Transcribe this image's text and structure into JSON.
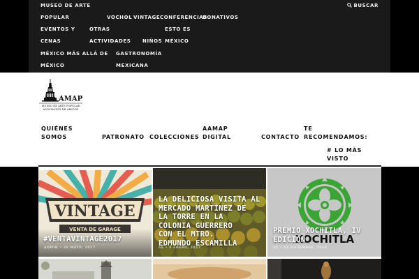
{
  "topbar": {
    "menu": [
      {
        "id": "museo",
        "label": "MUSEO DE ARTE"
      },
      {
        "id": "popular",
        "label": "POPULAR"
      },
      {
        "id": "vochol",
        "label": "VOCHOL"
      },
      {
        "id": "vintage",
        "label": "VINTAGE"
      },
      {
        "id": "conferencias",
        "label": "CONFERENCIAS"
      },
      {
        "id": "donativos",
        "label": "DONATIVOS"
      },
      {
        "id": "eventos",
        "label": "EVENTOS Y"
      },
      {
        "id": "otras",
        "label": "OTRAS"
      },
      {
        "id": "esto-es",
        "label": "ESTO ES"
      },
      {
        "id": "cenas",
        "label": "CENAS"
      },
      {
        "id": "actividades",
        "label": "ACTIVIDADES"
      },
      {
        "id": "ninos",
        "label": "NIÑOS"
      },
      {
        "id": "mexico",
        "label": "MÉXICO"
      },
      {
        "id": "mexico-mas",
        "label": "MÉXICO MÁS ALLÁ DE"
      },
      {
        "id": "gastronomia",
        "label": "GASTRONOMÍA"
      },
      {
        "id": "mexico2",
        "label": "MÉXICO"
      },
      {
        "id": "mexicana",
        "label": "MEXICANA"
      }
    ],
    "search_label": "BUSCAR",
    "search_icon": "search-icon"
  },
  "logo": {
    "wordmark": "AMAP",
    "lines": [
      "MUSEO DE ARTE POPULAR",
      "ASOCIACIÓN DE AMIGOS"
    ]
  },
  "nav": {
    "items": [
      {
        "id": "quienes-1",
        "label": "QUIÉNES"
      },
      {
        "id": "quienes-2",
        "label": "SOMOS"
      },
      {
        "id": "patronato",
        "label": "PATRONATO"
      },
      {
        "id": "colecciones",
        "label": "COLECCIONES"
      },
      {
        "id": "aamap-1",
        "label": "AAMAP"
      },
      {
        "id": "aamap-2",
        "label": "DIGITAL"
      },
      {
        "id": "contacto",
        "label": "CONTACTO"
      },
      {
        "id": "recomendamos-1",
        "label": "TE"
      },
      {
        "id": "recomendamos-2",
        "label": "RECOMENDAMOS:"
      },
      {
        "id": "lo-mas-1",
        "label": "# LO MÁS"
      },
      {
        "id": "lo-mas-2",
        "label": "VISTO"
      }
    ]
  },
  "posts": [
    {
      "title": "#VENTAVINTAGE2017",
      "meta": "ADMIN • 26 MAYO, 2017",
      "sign_word": "VINTAGE",
      "sign_sub": "VENTA DE GARAGE"
    },
    {
      "title_lines": [
        "LA DELICIOSA VISITA AL",
        "MERCADO MARTÍNEZ DE",
        "LA TORRE EN LA",
        "COLONIA GUERRERO",
        "CON EL MTRO.",
        "EDMUNDO ESCAMILLA"
      ],
      "meta": "SS • 8 ENERO, 2017"
    },
    {
      "title_lines": [
        "PREMIO XOCHITLA, IV",
        "EDICIÓN"
      ],
      "meta": "SS • 22 DICIEMBRE, 2016",
      "logo_word": "XOCHITLA"
    }
  ],
  "colors": {
    "topbar": "#1a1a1a",
    "xochitla_green": "#3aa535",
    "xochitla_bg": "#c7c7c7"
  }
}
